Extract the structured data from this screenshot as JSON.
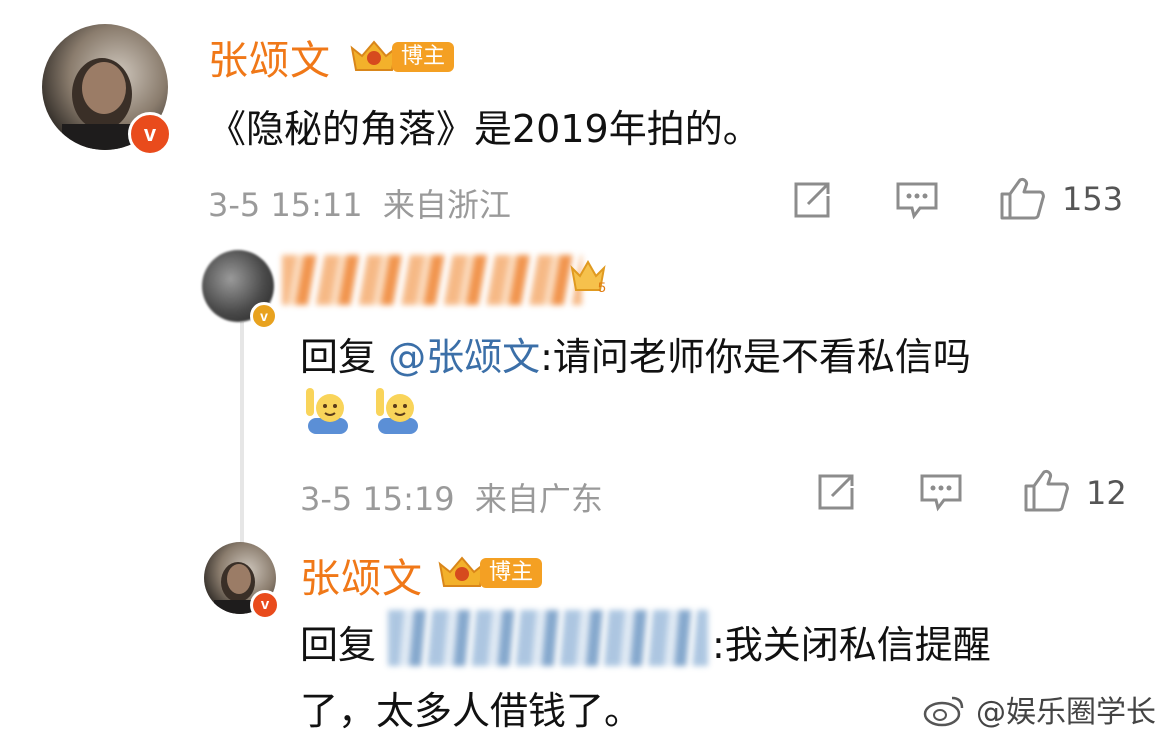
{
  "post": {
    "author": "张颂文",
    "badge_label": "博主",
    "text": "《隐秘的角落》是2019年拍的。",
    "timestamp": "3-5 15:11",
    "source": "来自浙江",
    "likes": "153"
  },
  "reply1": {
    "prefix": "回复 ",
    "mention": "@张颂文",
    "text": ":请问老师你是不看私信吗",
    "timestamp": "3-5 15:19",
    "source": "来自广东",
    "likes": "12"
  },
  "reply2": {
    "author": "张颂文",
    "badge_label": "博主",
    "prefix": "回复",
    "text_line1": ":我关闭私信提醒",
    "text_line2": "了，太多人借钱了。"
  },
  "watermark": "@娱乐圈学长",
  "icons": [
    "share-icon",
    "comment-icon",
    "like-icon",
    "verified-icon",
    "crown-icon",
    "weibo-logo-icon"
  ],
  "colors": {
    "name": "#f07818",
    "mention": "#3b6fa8",
    "badge": "#f4a023",
    "meta": "#9a9a9a"
  }
}
